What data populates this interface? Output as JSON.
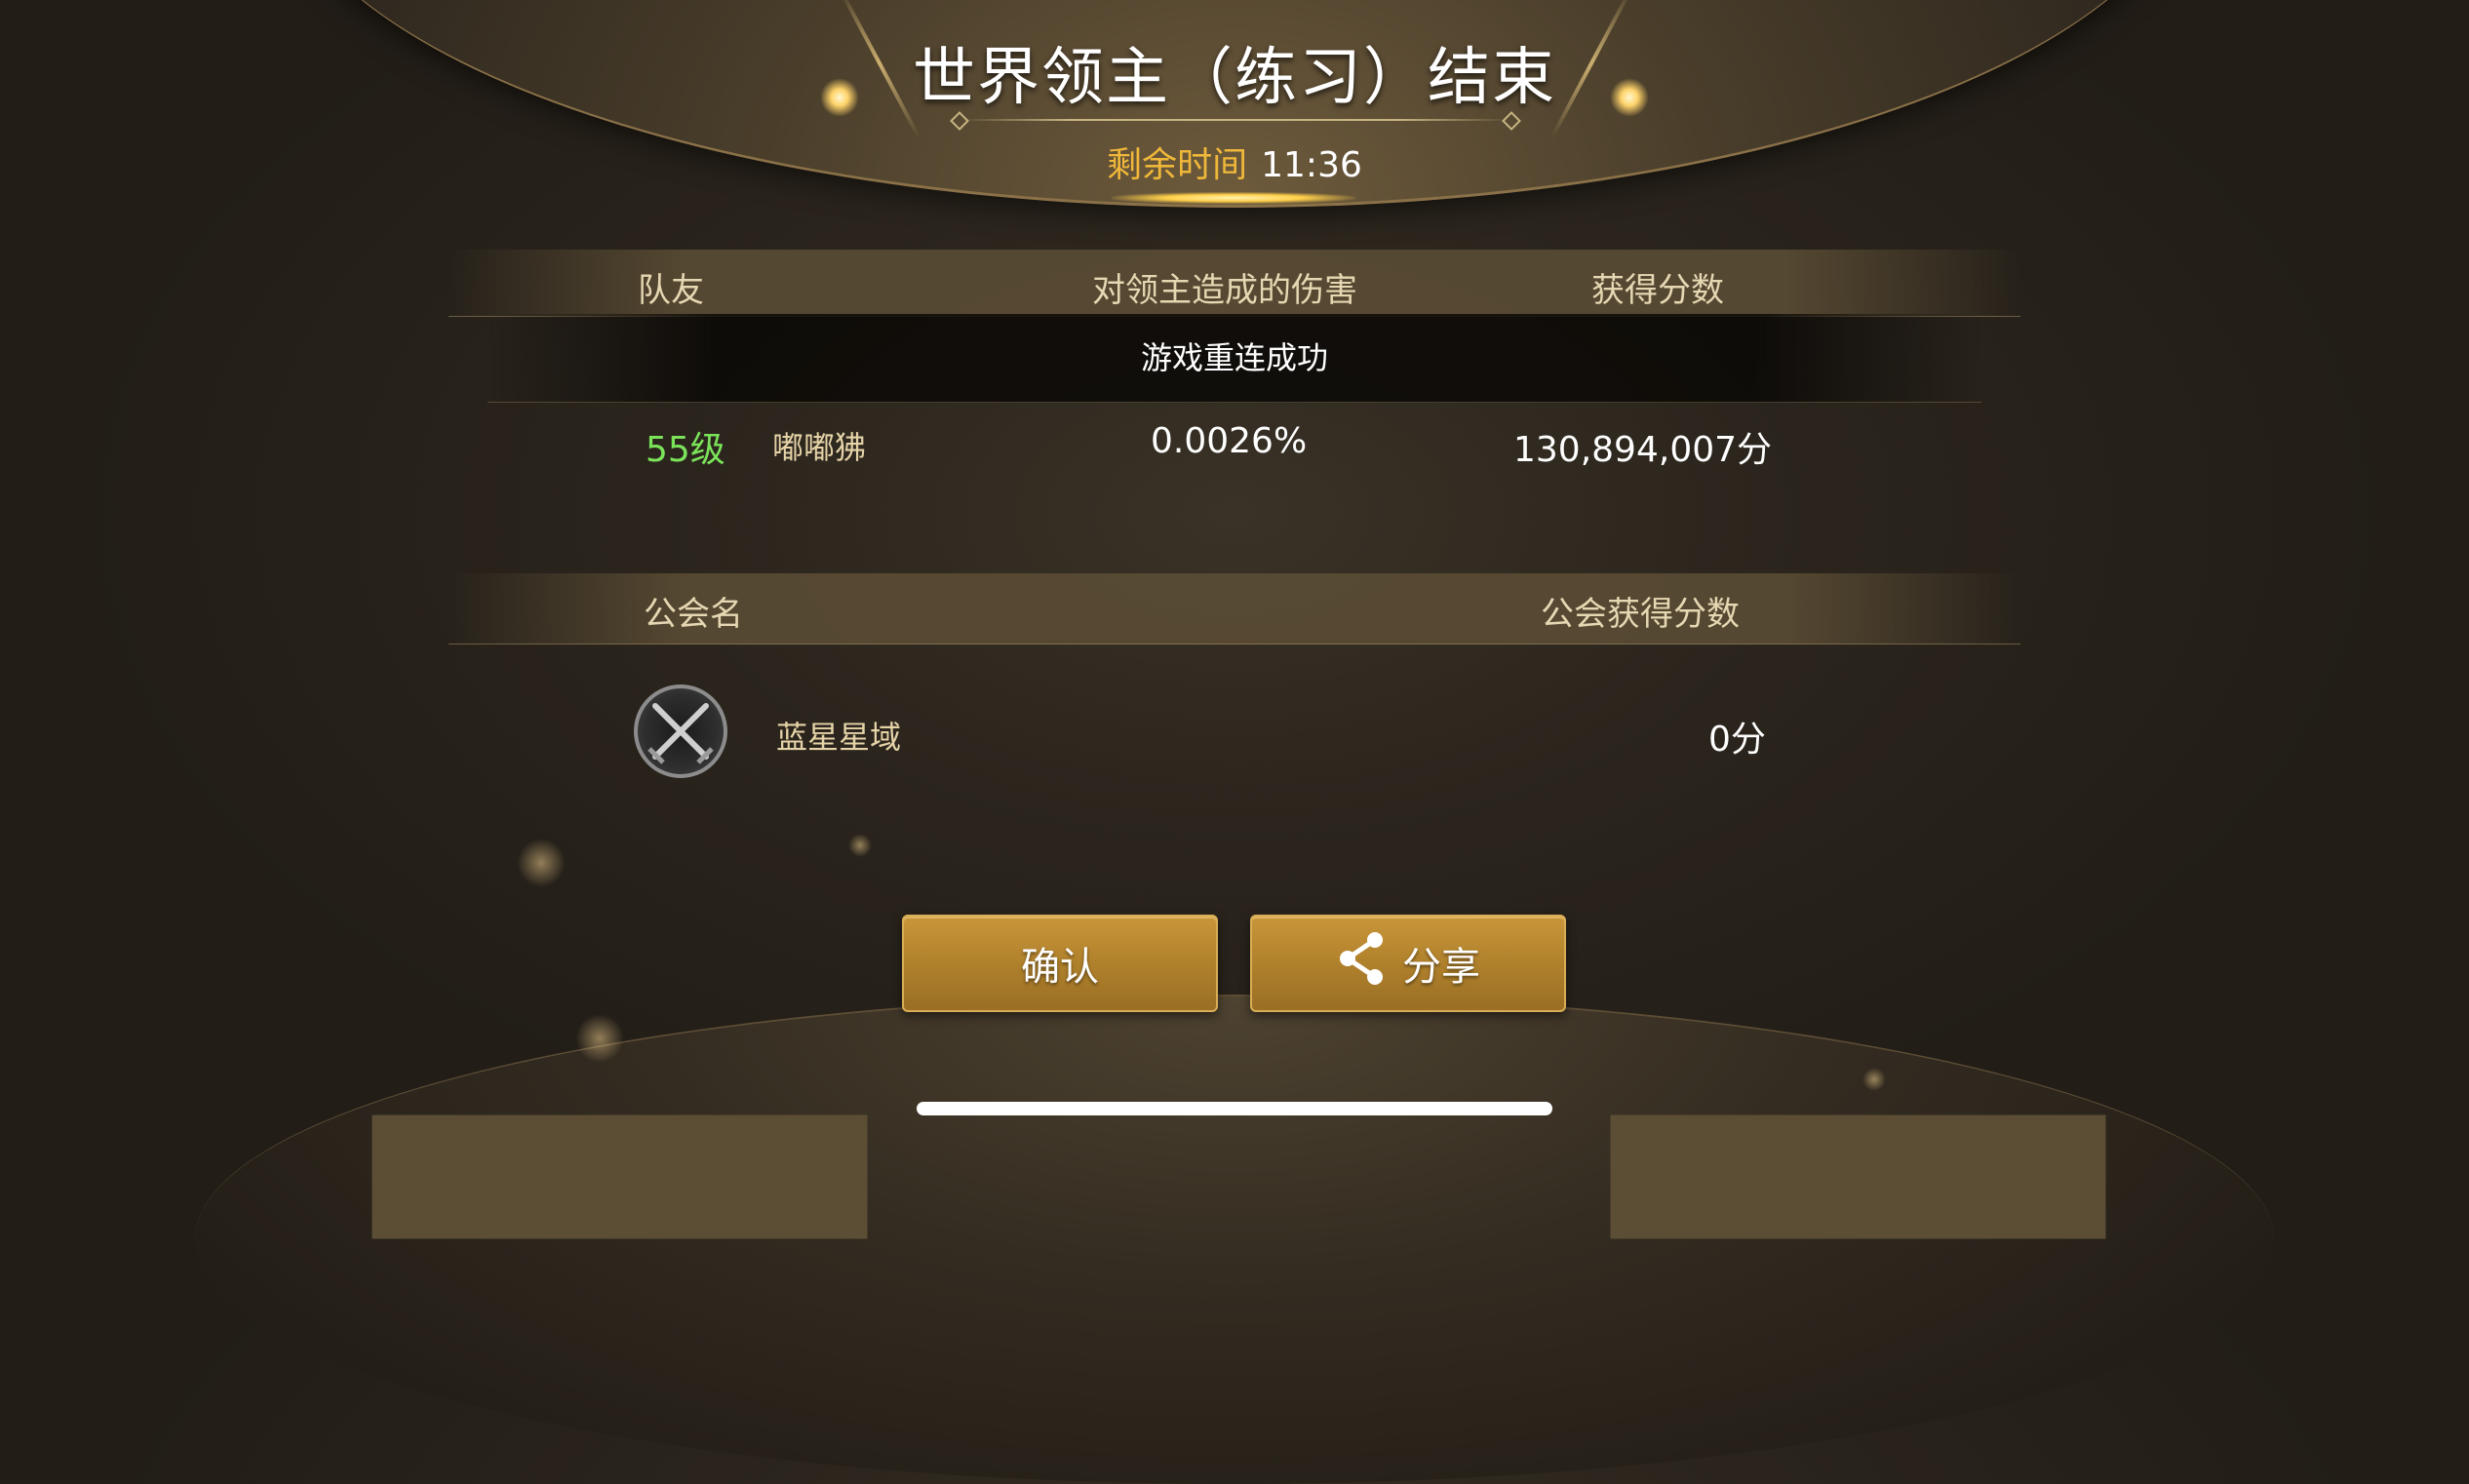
{
  "title": "世界领主（练习）结束",
  "timer": {
    "label": "剩余时间",
    "value": "11:36"
  },
  "team_table": {
    "headers": {
      "teammate": "队友",
      "damage": "对领主造成的伤害",
      "score": "获得分数"
    },
    "toast": "游戏重连成功",
    "rows": [
      {
        "level": "55级",
        "name": "嘟嘟狒",
        "damage": "0.0026%",
        "score": "130,894,007分"
      }
    ]
  },
  "guild_table": {
    "headers": {
      "guild_name": "公会名",
      "guild_score": "公会获得分数"
    },
    "rows": [
      {
        "emblem_icon": "crossed-swords-icon",
        "name": "蓝星星域",
        "score": "0分"
      }
    ]
  },
  "buttons": {
    "confirm": "确认",
    "share": "分享",
    "share_icon": "share-icon"
  },
  "colors": {
    "level": "#7be35a",
    "timer_label": "#f0b83a",
    "button": "#b0812c"
  }
}
